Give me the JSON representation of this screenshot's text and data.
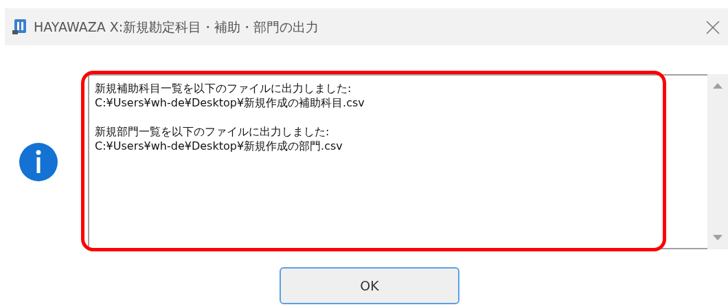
{
  "window": {
    "title": "HAYAWAZA X:新規勘定科目・補助・部門の出力"
  },
  "message": {
    "paragraphs": [
      {
        "lines": [
          "新規補助科目一覧を以下のファイルに出力しました:",
          "C:¥Users¥wh-de¥Desktop¥新規作成の補助科目.csv"
        ]
      },
      {
        "lines": [
          "新規部門一覧を以下のファイルに出力しました:",
          "C:¥Users¥wh-de¥Desktop¥新規作成の部門.csv"
        ]
      }
    ]
  },
  "buttons": [
    {
      "label": "OK",
      "focused": true
    }
  ]
}
